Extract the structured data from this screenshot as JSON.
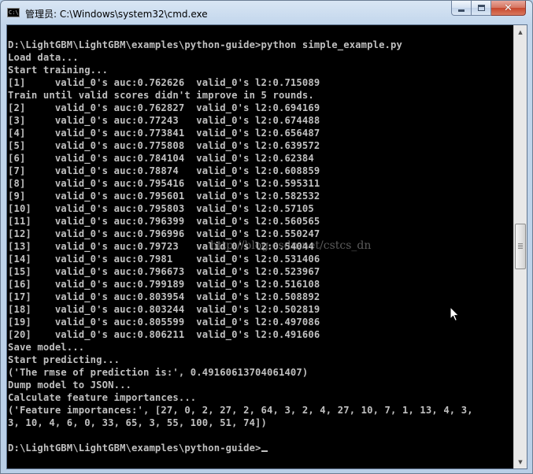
{
  "window": {
    "title": "管理员: C:\\Windows\\system32\\cmd.exe",
    "app_icon_text": "C:\\",
    "icons": {
      "app": "cmd-icon",
      "minimize": "minimize-icon",
      "maximize": "maximize-icon",
      "close": "close-icon",
      "scroll_up": "arrow-up-icon",
      "scroll_down": "arrow-down-icon",
      "pointer": "mouse-pointer-icon"
    }
  },
  "console": {
    "lines": [
      "D:\\LightGBM\\LightGBM\\examples\\python-guide>python simple_example.py",
      "Load data...",
      "Start training...",
      "[1]     valid_0's auc:0.762626  valid_0's l2:0.715089",
      "Train until valid scores didn't improve in 5 rounds.",
      "[2]     valid_0's auc:0.762827  valid_0's l2:0.694169",
      "[3]     valid_0's auc:0.77243   valid_0's l2:0.674488",
      "[4]     valid_0's auc:0.773841  valid_0's l2:0.656487",
      "[5]     valid_0's auc:0.775808  valid_0's l2:0.639572",
      "[6]     valid_0's auc:0.784104  valid_0's l2:0.62384",
      "[7]     valid_0's auc:0.78874   valid_0's l2:0.608859",
      "[8]     valid_0's auc:0.795416  valid_0's l2:0.595311",
      "[9]     valid_0's auc:0.795601  valid_0's l2:0.582532",
      "[10]    valid_0's auc:0.795803  valid_0's l2:0.57105",
      "[11]    valid_0's auc:0.796399  valid_0's l2:0.560565",
      "[12]    valid_0's auc:0.796996  valid_0's l2:0.550247",
      "[13]    valid_0's auc:0.79723   valid_0's l2:0.54044",
      "[14]    valid_0's auc:0.7981    valid_0's l2:0.531406",
      "[15]    valid_0's auc:0.796673  valid_0's l2:0.523967",
      "[16]    valid_0's auc:0.799189  valid_0's l2:0.516108",
      "[17]    valid_0's auc:0.803954  valid_0's l2:0.508892",
      "[18]    valid_0's auc:0.803244  valid_0's l2:0.502819",
      "[19]    valid_0's auc:0.805599  valid_0's l2:0.497086",
      "[20]    valid_0's auc:0.806211  valid_0's l2:0.491606",
      "Save model...",
      "Start predicting...",
      "('The rmse of prediction is:', 0.49160613704061407)",
      "Dump model to JSON...",
      "Calculate feature importances...",
      "('Feature importances:', [27, 0, 2, 27, 2, 64, 3, 2, 4, 27, 10, 7, 1, 13, 4, 3,",
      "3, 10, 4, 6, 0, 33, 65, 3, 55, 100, 51, 74])",
      "",
      "D:\\LightGBM\\LightGBM\\examples\\python-guide>"
    ],
    "watermark": "http://blog.csdn.net/cstcs_dn",
    "text_color": "#c0c0c0",
    "background_color": "#000000"
  }
}
